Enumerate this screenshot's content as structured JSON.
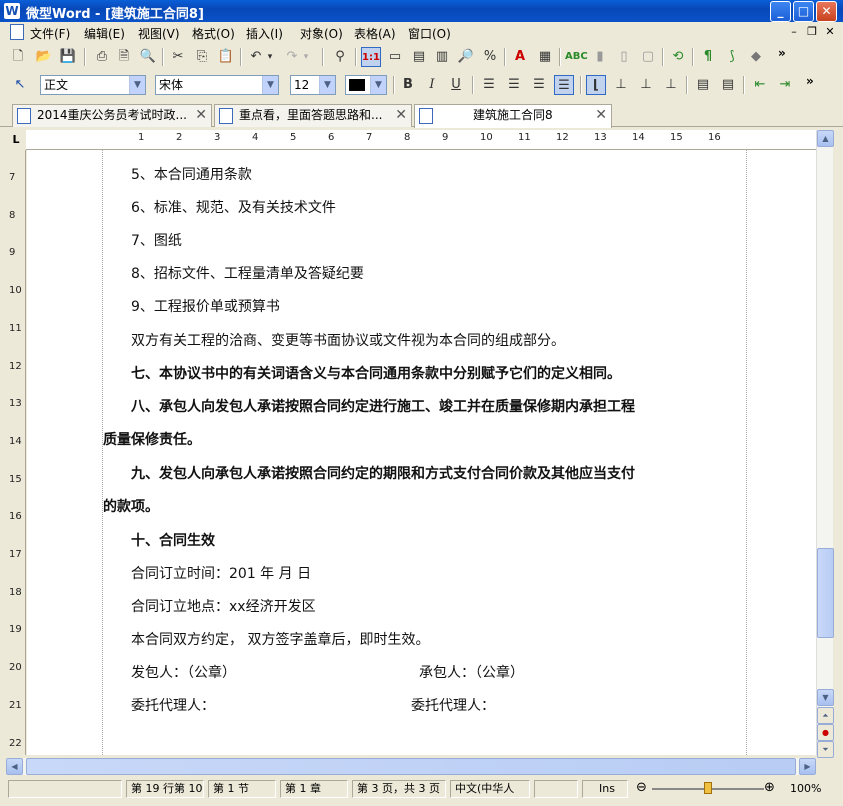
{
  "window": {
    "title": "微型Word - [建筑施工合同8]",
    "app_icon": "W",
    "minimize": "_",
    "maximize": "□",
    "close": "✕"
  },
  "menu": {
    "items": [
      "文件(F)",
      "编辑(E)",
      "视图(V)",
      "格式(O)",
      "插入(I)",
      "对象(O)",
      "表格(A)",
      "窗口(O)"
    ],
    "mdi_minimize": "–",
    "mdi_restore": "❐",
    "mdi_close": "✕"
  },
  "format_bar": {
    "style": "正文",
    "font": "宋体",
    "size": "12",
    "more": "»"
  },
  "standard_bar": {
    "more": "»"
  },
  "tabs": [
    {
      "label": "2014重庆公务员考试时政...",
      "close": "✕"
    },
    {
      "label": "重点看，里面答题思路和...",
      "close": "✕"
    },
    {
      "label": "建筑施工合同8",
      "close": "✕"
    }
  ],
  "ruler": {
    "corner": "L",
    "h_ticks": [
      "1",
      "2",
      "3",
      "4",
      "5",
      "6",
      "7",
      "8",
      "9",
      "10",
      "11",
      "12",
      "13",
      "14",
      "15",
      "16"
    ],
    "v_ticks": [
      "7",
      "8",
      "9",
      "10",
      "11",
      "12",
      "13",
      "14",
      "15",
      "16",
      "17",
      "18",
      "19",
      "20",
      "21",
      "22"
    ]
  },
  "document": {
    "lines": [
      {
        "text": "5、本合同通用条款",
        "bold": false
      },
      {
        "text": "6、标准、规范、及有关技术文件",
        "bold": false
      },
      {
        "text": "7、图纸",
        "bold": false
      },
      {
        "text": "8、招标文件、工程量清单及答疑纪要",
        "bold": false
      },
      {
        "text": "9、工程报价单或预算书",
        "bold": false
      },
      {
        "text": "双方有关工程的洽商、变更等书面协议或文件视为本合同的组成部分。",
        "bold": false
      },
      {
        "text": "七、本协议书中的有关词语含义与本合同通用条款中分别赋予它们的定义相同。",
        "bold": true
      },
      {
        "text": "八、承包人向发包人承诺按照合同约定进行施工、竣工并在质量保修期内承担工程",
        "bold": true
      },
      {
        "text": "质量保修责任。",
        "bold": true
      },
      {
        "text": "九、发包人向承包人承诺按照合同约定的期限和方式支付合同价款及其他应当支付",
        "bold": true
      },
      {
        "text": "的款项。",
        "bold": true
      },
      {
        "text": "十、合同生效",
        "bold": true
      },
      {
        "text": "合同订立时间：201 年   月   日",
        "bold": false
      },
      {
        "text": "合同订立地点：xx经济开发区",
        "bold": false
      },
      {
        "text": "本合同双方约定，  双方签字盖章后，即时生效。",
        "bold": false
      },
      {
        "text": "发包人：（公章）",
        "bold": false
      },
      {
        "text": "委托代理人：",
        "bold": false
      }
    ],
    "right_col": [
      {
        "text": "承包人：（公章）"
      },
      {
        "text": "委托代理人："
      }
    ]
  },
  "status": {
    "line": "第 19 行第 10",
    "section": "第 1 节",
    "chapter": "第 1 章",
    "pages": "第 3 页，共 3 页",
    "language": "中文(中华人",
    "ins": "Ins",
    "zoom": "100%",
    "zoom_level": 1.0
  },
  "colors": {
    "titlebar": "#0a52c8",
    "accent": "#316ac5"
  }
}
